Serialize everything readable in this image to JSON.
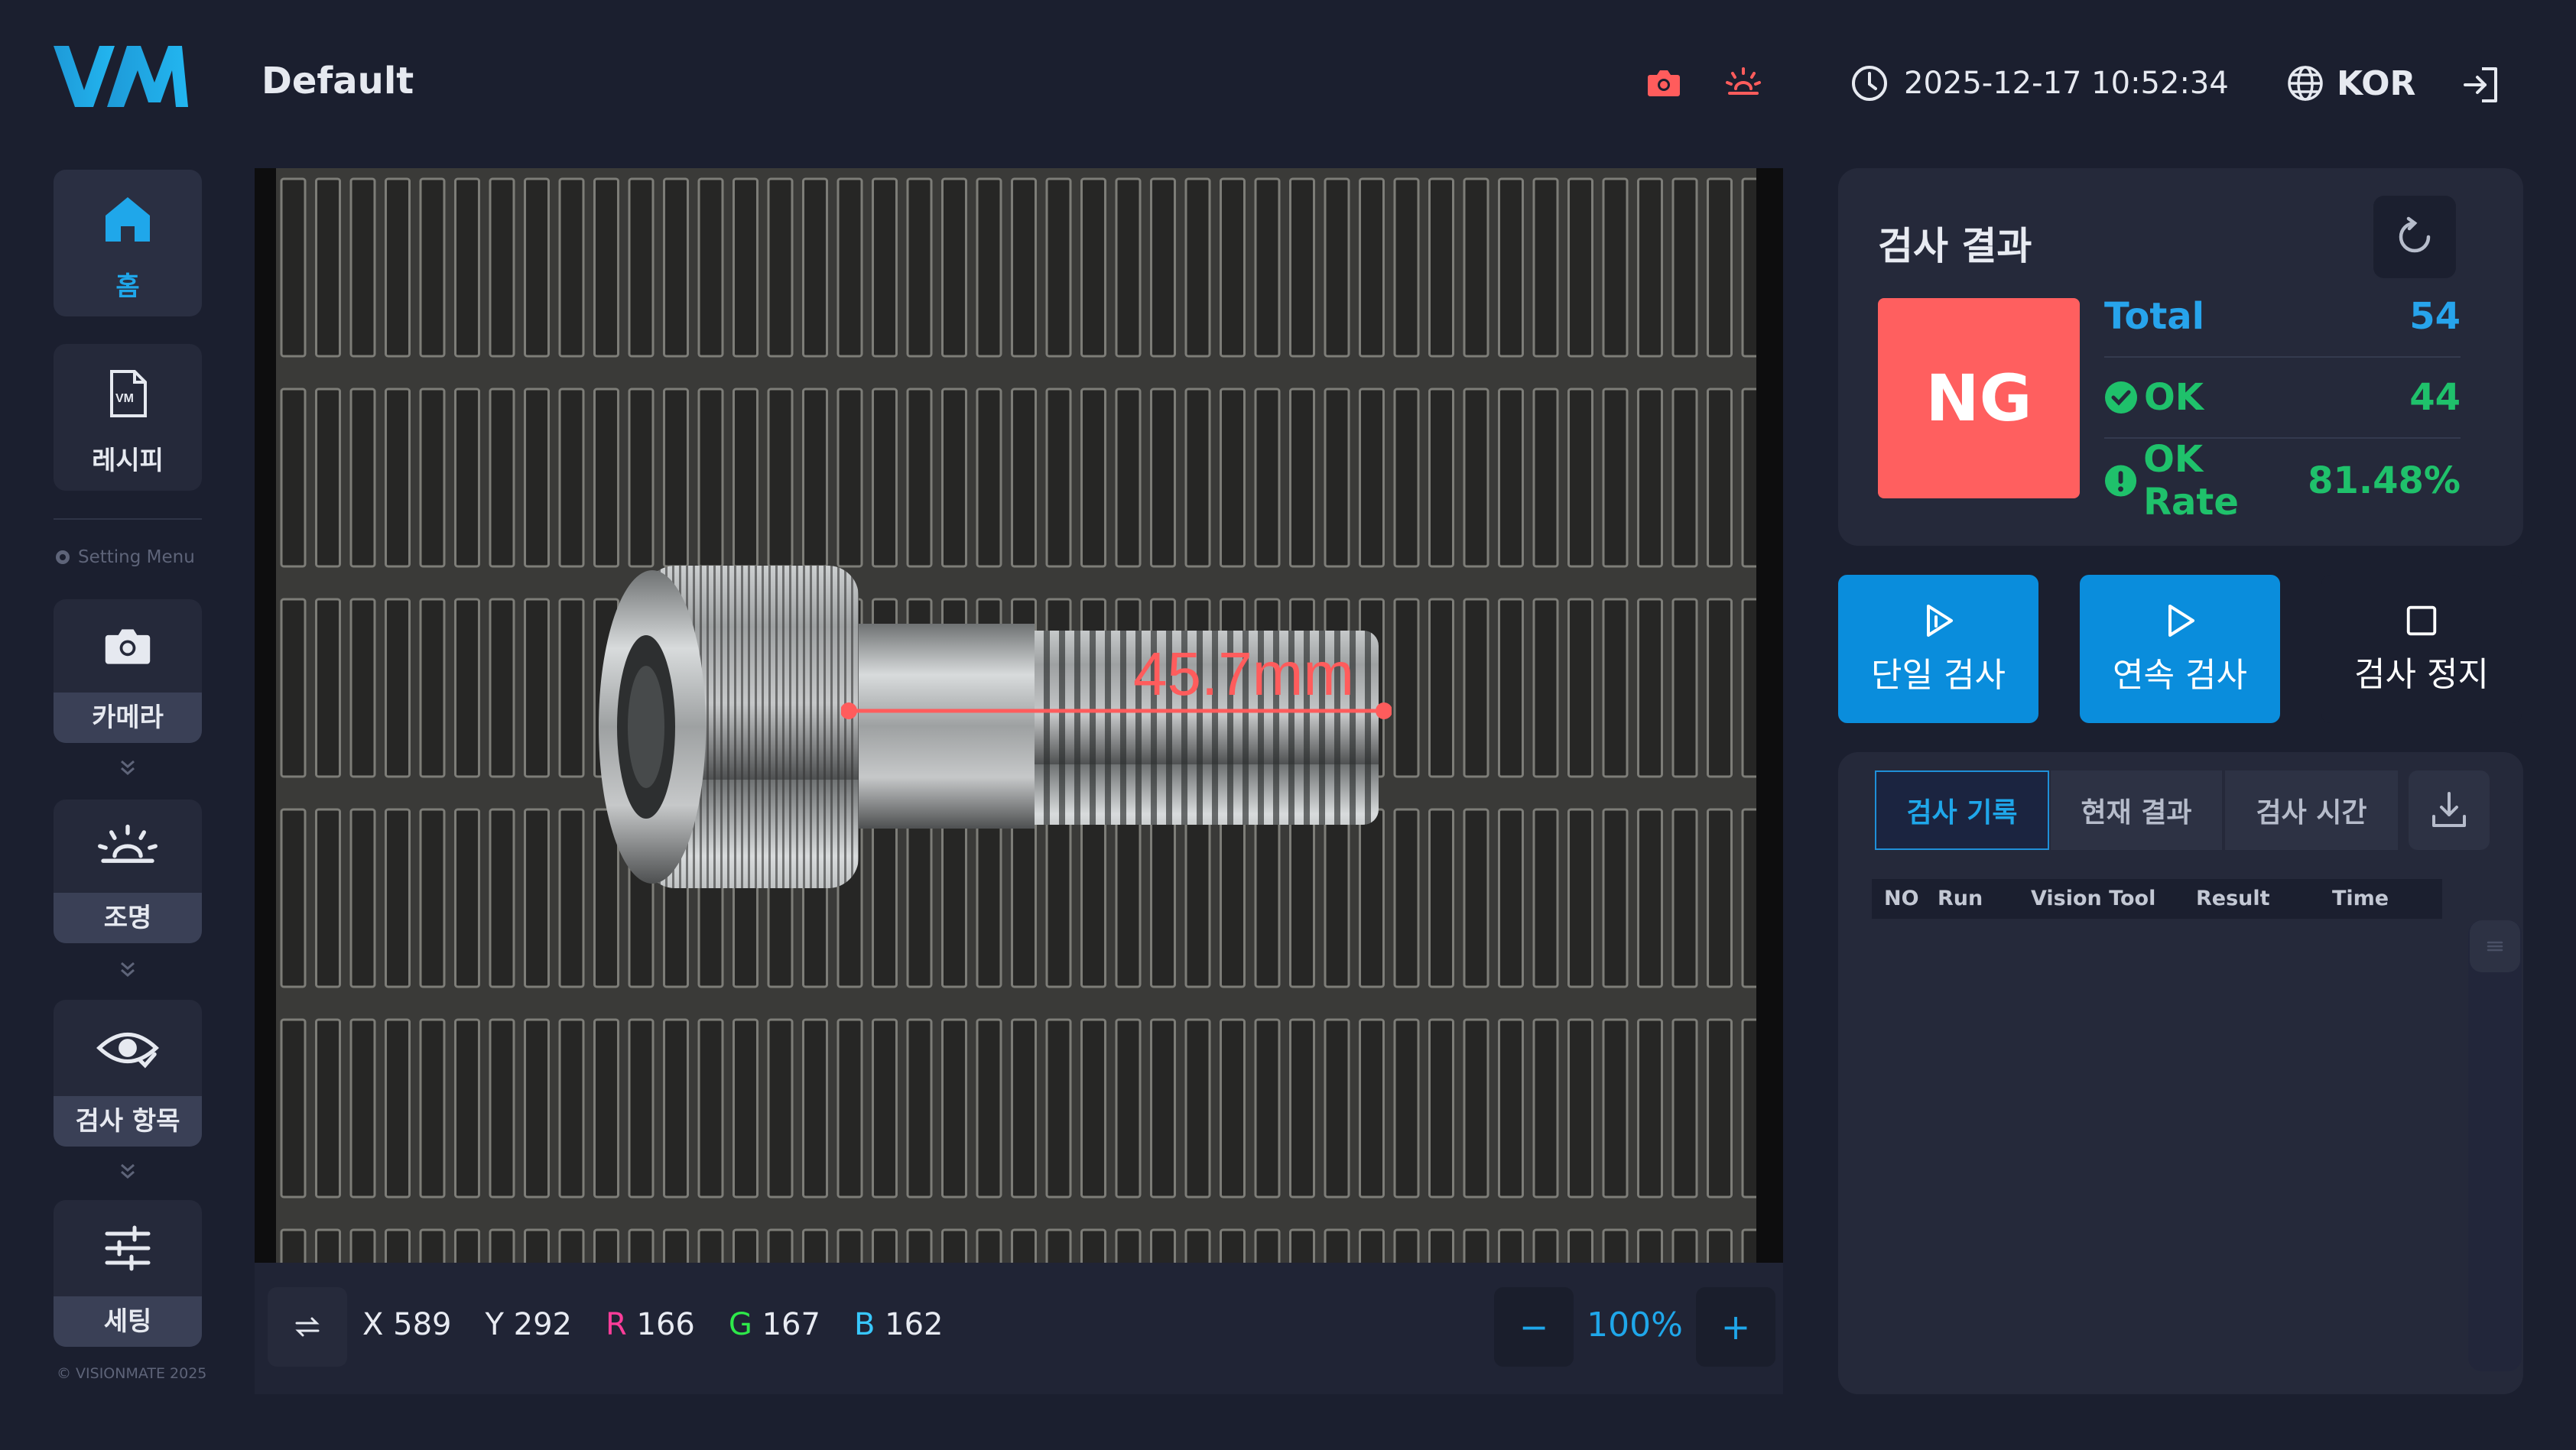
{
  "header": {
    "recipe_name": "Default",
    "datetime": "2025-12-17 10:52:34",
    "language": "KOR",
    "icons": {
      "camera": "camera-icon",
      "light": "light-icon",
      "clock": "clock-icon",
      "globe": "globe-icon",
      "logout": "logout-icon"
    },
    "camera_icon_color": "#ff5c5c"
  },
  "sidebar": {
    "home": "홈",
    "recipe": "레시피",
    "setting_menu": "Setting Menu",
    "camera": "카메라",
    "lighting": "조명",
    "inspection_items": "검사 항목",
    "settings": "세팅",
    "copyright": "© VISIONMATE 2025"
  },
  "viewer": {
    "measurement": "45.7mm",
    "x_label": "X",
    "x_value": "589",
    "y_label": "Y",
    "y_value": "292",
    "r_label": "R",
    "r_value": "166",
    "g_label": "G",
    "g_value": "167",
    "b_label": "B",
    "b_value": "162",
    "zoom": "100%",
    "zoom_out": "−",
    "zoom_in": "+"
  },
  "result": {
    "title": "검사 결과",
    "status": "NG",
    "total_label": "Total",
    "total_value": "54",
    "ok_label": "OK",
    "ok_value": "44",
    "ok_rate_label": "OK Rate",
    "ok_rate_value": "81.48%"
  },
  "actions": {
    "single": "단일 검사",
    "continuous": "연속 검사",
    "stop": "검사 정지"
  },
  "history": {
    "tabs": [
      "검사 기록",
      "현재 결과",
      "검사 시간"
    ],
    "columns": [
      "NO",
      "Run",
      "Vision Tool",
      "Result",
      "Time"
    ],
    "rows": []
  },
  "colors": {
    "background": "#1b1f2f",
    "panel": "#25293a",
    "accent_blue": "#0a8ddc",
    "brand": "#16a3e8",
    "ng_red": "#ff5f5f",
    "ok_green": "#1fc16b",
    "total_blue": "#27a4ec",
    "measure_red": "#ff5c5c",
    "r_channel": "#ff3d9a",
    "g_channel": "#2ee84a",
    "b_channel": "#38c8ff"
  }
}
